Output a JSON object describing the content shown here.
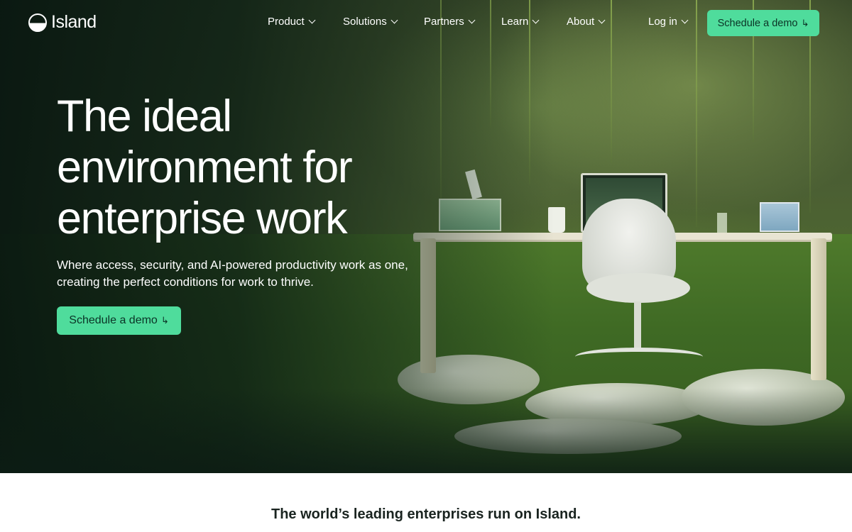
{
  "brand": {
    "name": "Island"
  },
  "nav": {
    "items": [
      {
        "label": "Product"
      },
      {
        "label": "Solutions"
      },
      {
        "label": "Partners"
      },
      {
        "label": "Learn"
      },
      {
        "label": "About"
      }
    ],
    "login_label": "Log in",
    "cta_label": "Schedule a demo",
    "cta_arrow": "↳"
  },
  "hero": {
    "headline_line1": "The ideal",
    "headline_line2": "environment for",
    "headline_line3": "enterprise work",
    "subtext_line1": "Where access, security, and AI-powered productivity work as one,",
    "subtext_line2": "creating the perfect conditions for work to thrive.",
    "cta_label": "Schedule a demo",
    "cta_arrow": "↳"
  },
  "trust": {
    "text": "The world’s leading enterprises run on Island."
  },
  "colors": {
    "accent": "#4fdc9c",
    "accent_text": "#0b3326",
    "hero_dark": "#0c1e14"
  }
}
